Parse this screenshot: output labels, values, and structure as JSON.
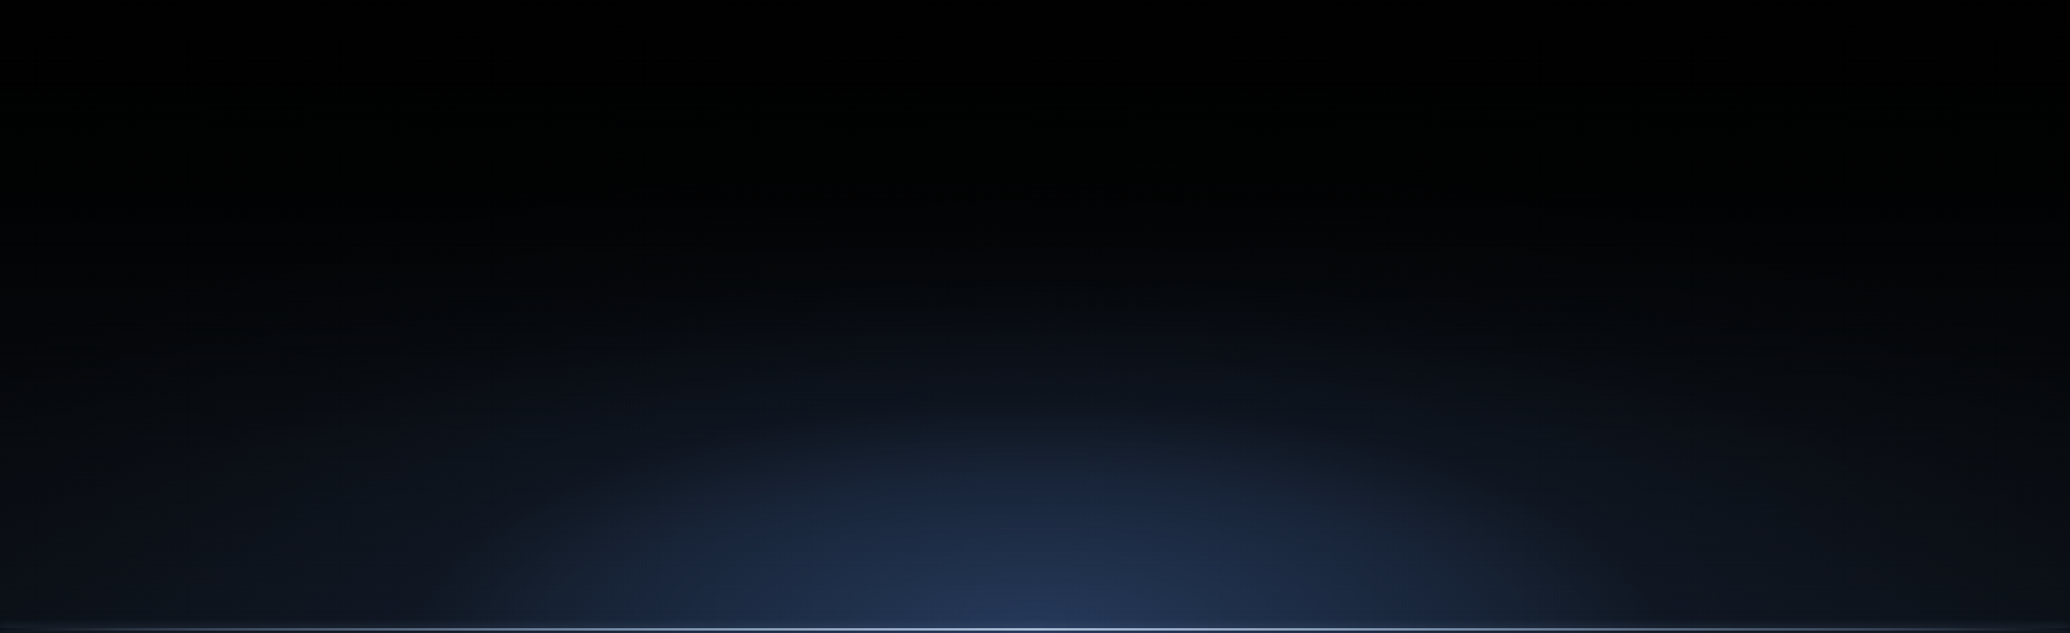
{
  "colors": {
    "top": "#000000",
    "glow_center": "#1f2e48",
    "bottom_edge": "#121a26",
    "horizon_line": "#afc3dc"
  }
}
